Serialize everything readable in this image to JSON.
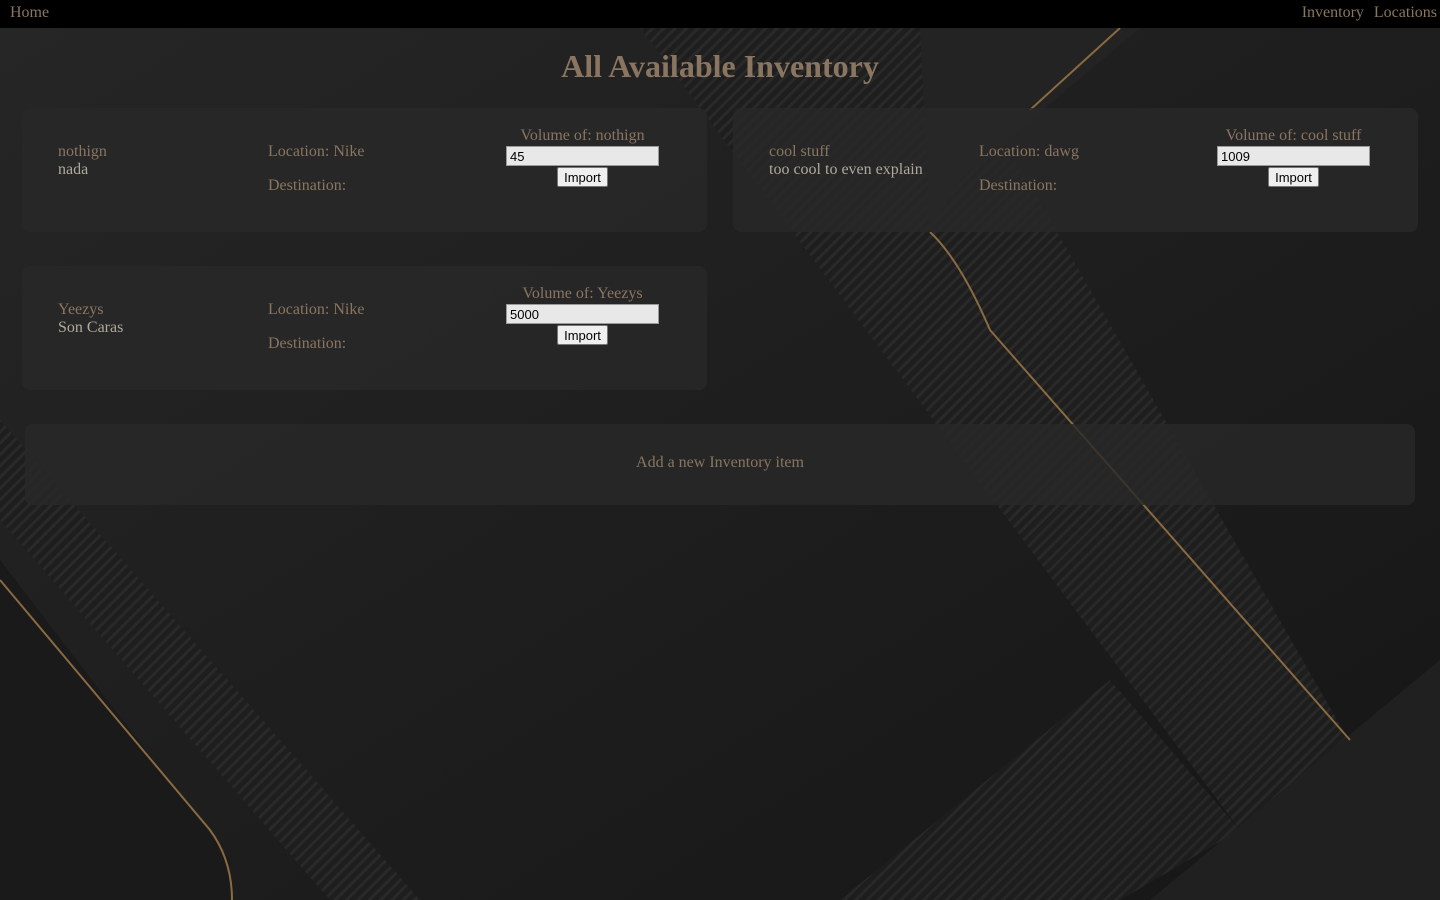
{
  "nav": {
    "home_label": "Home",
    "inventory_label": "Inventory",
    "locations_label": "Locations"
  },
  "page_title": "All Available Inventory",
  "items": [
    {
      "name": "nothign",
      "description": "nada",
      "location": "Location: Nike",
      "destination": "Destination:",
      "volume_label": "Volume of: nothign",
      "volume_value": "45",
      "import_label": "Import"
    },
    {
      "name": "cool stuff",
      "description": "too cool to even explain",
      "location": "Location: dawg",
      "destination": "Destination:",
      "volume_label": "Volume of: cool stuff",
      "volume_value": "1009",
      "import_label": "Import"
    },
    {
      "name": "Yeezys",
      "description": "Son Caras",
      "location": "Location: Nike",
      "destination": "Destination:",
      "volume_label": "Volume of: Yeezys",
      "volume_value": "5000",
      "import_label": "Import"
    }
  ],
  "add_item_label": "Add a new Inventory item",
  "colors": {
    "accent": "#8a7560",
    "nav_bg": "#000000",
    "page_bg": "#1b1b1b",
    "card_bg": "#282828"
  }
}
